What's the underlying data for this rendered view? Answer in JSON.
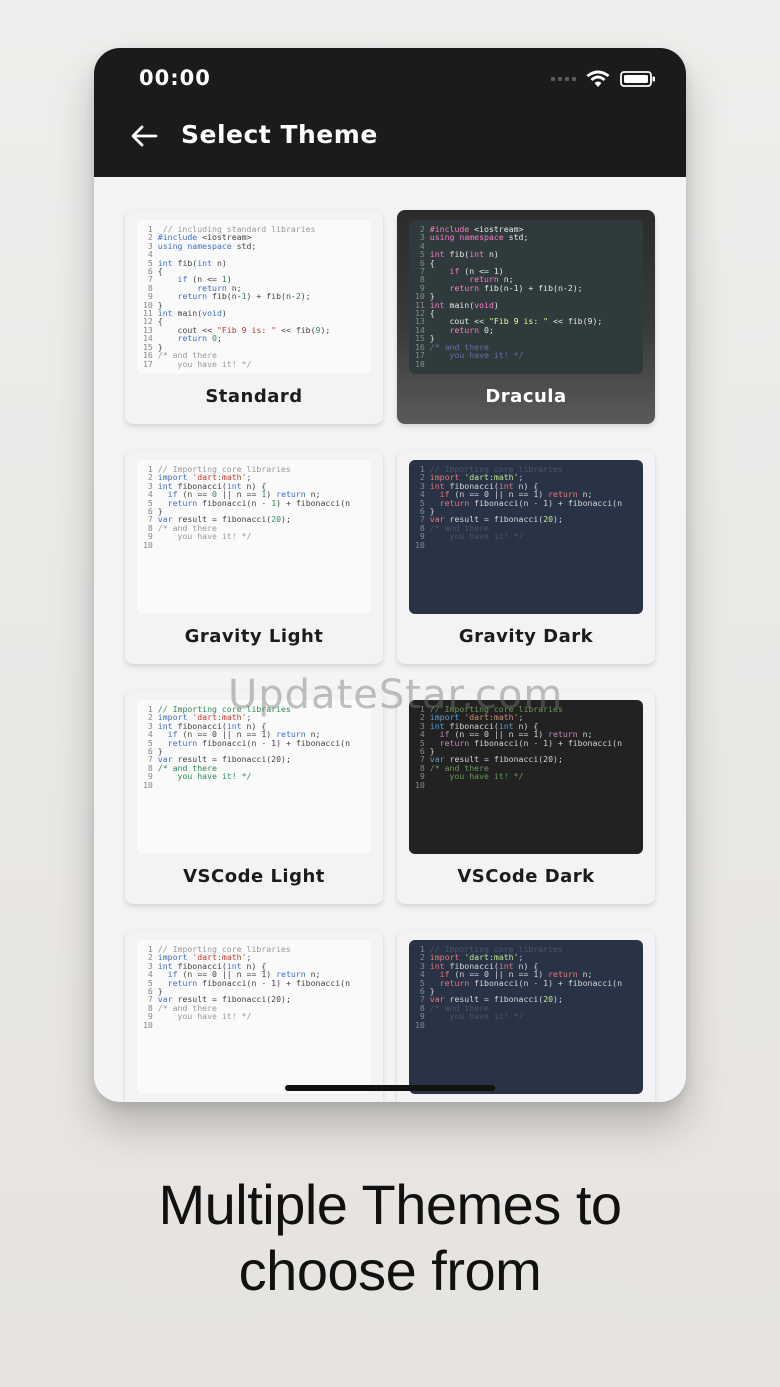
{
  "status": {
    "time": "00:00"
  },
  "header": {
    "title": "Select Theme"
  },
  "themes": [
    {
      "label": "Standard"
    },
    {
      "label": "Dracula"
    },
    {
      "label": "Gravity Light"
    },
    {
      "label": "Gravity Dark"
    },
    {
      "label": "VSCode Light"
    },
    {
      "label": "VSCode Dark"
    },
    {
      "label": ""
    },
    {
      "label": ""
    }
  ],
  "watermark": "UpdateStar.com",
  "caption": {
    "line1": "Multiple Themes to",
    "line2": "choose from"
  },
  "colors": {
    "appbar": "#1b1b1b",
    "background": "#efeeec"
  },
  "icons": [
    "back-arrow-icon",
    "wifi-icon",
    "battery-icon",
    "signal-icon"
  ]
}
